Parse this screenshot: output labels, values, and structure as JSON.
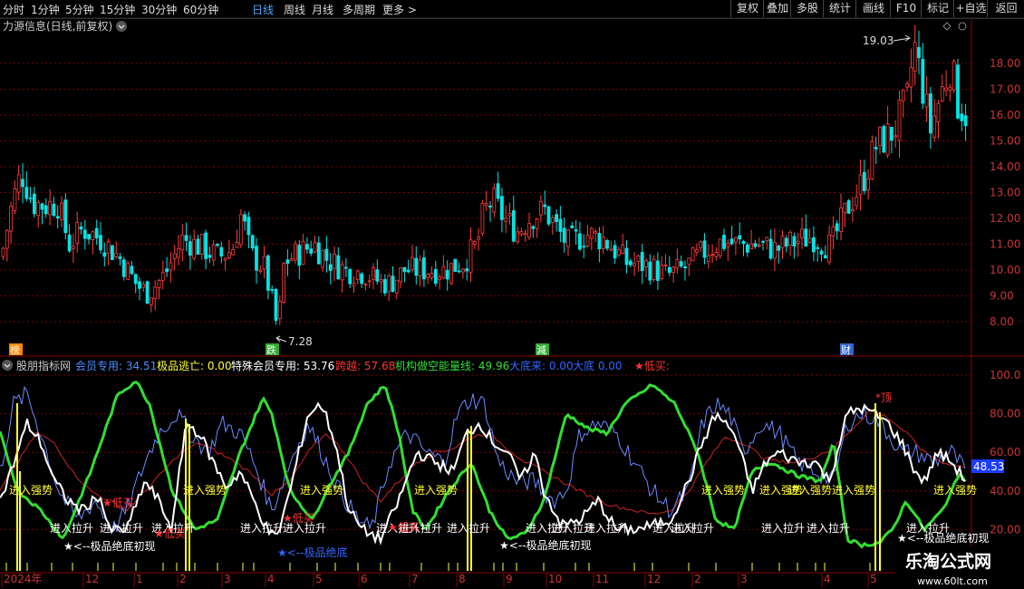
{
  "toolbar": {
    "periods": [
      "分时",
      "1分钟",
      "5分钟",
      "15分钟",
      "30分钟",
      "60分钟",
      "日线",
      "周线",
      "月线",
      "多周期",
      "更多 >"
    ],
    "selected": "日线",
    "right_buttons": [
      "复权",
      "叠加",
      "多股",
      "统计",
      "画线",
      "F10",
      "标记",
      "+自选",
      "返回"
    ]
  },
  "main_panel": {
    "title": "力源信息(日线,前复权)",
    "high_label": "19.03",
    "low_label": "7.28",
    "y_ticks": [
      "18.00",
      "17.00",
      "16.00",
      "15.00",
      "14.00",
      "13.00",
      "12.00",
      "11.00",
      "10.00",
      "9.00",
      "8.00"
    ],
    "event_badges": [
      "榜",
      "跌",
      "減",
      "财"
    ],
    "colors": {
      "up": "#ff3c3c",
      "down": "#00e5e5",
      "grid": "#7a0000"
    }
  },
  "indicator_panel": {
    "legend": [
      {
        "label": "股朋指标网",
        "color": "#cccccc"
      },
      {
        "label": "会员专用:",
        "value": "34.51",
        "color": "#4d8cff"
      },
      {
        "label": "极品逃亡:",
        "value": "0.00",
        "color": "#ffff33"
      },
      {
        "label": "特殊会员专用:",
        "value": "53.76",
        "color": "#ffffff"
      },
      {
        "label": "跨越:",
        "value": "57.68",
        "color": "#ff3333"
      },
      {
        "label": "机构做空能量线:",
        "value": "49.96",
        "color": "#33dd33"
      },
      {
        "label": "大底来:",
        "value": "0.00",
        "color": "#3366ff"
      },
      {
        "label": "大底",
        "value": "0.00",
        "color": "#3366ff"
      },
      {
        "label": "★低买:",
        "value": "",
        "color": "#ff3333"
      }
    ],
    "y_ticks": [
      "100.0",
      "80.00",
      "60.00",
      "40.00",
      "20.00"
    ],
    "current_value": "48.53",
    "annotations": {
      "strong": [
        "进入强势",
        "进入强势",
        "进入强势",
        "进入强势",
        "进入强势",
        "进入强势",
        "进入强势",
        "进入强势",
        "进入强势"
      ],
      "lift": [
        "进入拉升",
        "进入拉升",
        "进入拉升",
        "进入拉升",
        "进入拉升",
        "进入拉升",
        "进入拉升",
        "进入拉升",
        "进入拉升",
        "进入拉升",
        "进入拉升",
        "进入拉升",
        "进入拉升",
        "进入拉升",
        "进入拉升",
        "进入拉升"
      ],
      "low_buy": [
        "★低买",
        "★低买",
        "★低买",
        "★低买"
      ],
      "bottom_first": [
        "★<--极品绝底初现",
        "★<--极品绝底初现",
        "★<--极品绝底初现"
      ],
      "bottom": "★<--极品绝底",
      "top": "*顶"
    }
  },
  "x_axis": {
    "labels": [
      "2024年",
      "12",
      "1",
      "2",
      "3",
      "4",
      "5",
      "6",
      "7",
      "8",
      "9",
      "10",
      "11",
      "12",
      "2",
      "3",
      "4",
      "5"
    ]
  },
  "watermark": {
    "line1": "乐淘公式网",
    "line2": "www.60lt.com"
  }
}
